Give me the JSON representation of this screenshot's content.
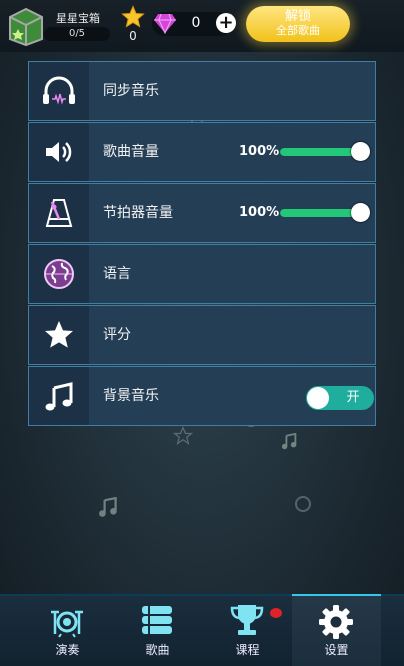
{
  "topbar": {
    "chest_title": "星星宝箱",
    "chest_progress": "0/5",
    "stars": "0",
    "gems": "0",
    "unlock_line1": "解锁",
    "unlock_line2": "全部歌曲"
  },
  "settings": {
    "sync_music": "同步音乐",
    "song_volume": {
      "label": "歌曲音量",
      "value": "100%",
      "level": 1.0
    },
    "metronome_volume": {
      "label": "节拍器音量",
      "value": "100%",
      "level": 1.0
    },
    "language": "语言",
    "rating": "评分",
    "background_music": {
      "label": "背景音乐",
      "state": "开",
      "on": true
    }
  },
  "nav": {
    "perform": "演奏",
    "songs": "歌曲",
    "courses": "课程",
    "settings": "设置"
  },
  "colors": {
    "accent_green": "#22c777",
    "toggle_on": "#1fae9e",
    "unlock_gold": "#f1c21b",
    "notification_red": "#e0222a"
  }
}
